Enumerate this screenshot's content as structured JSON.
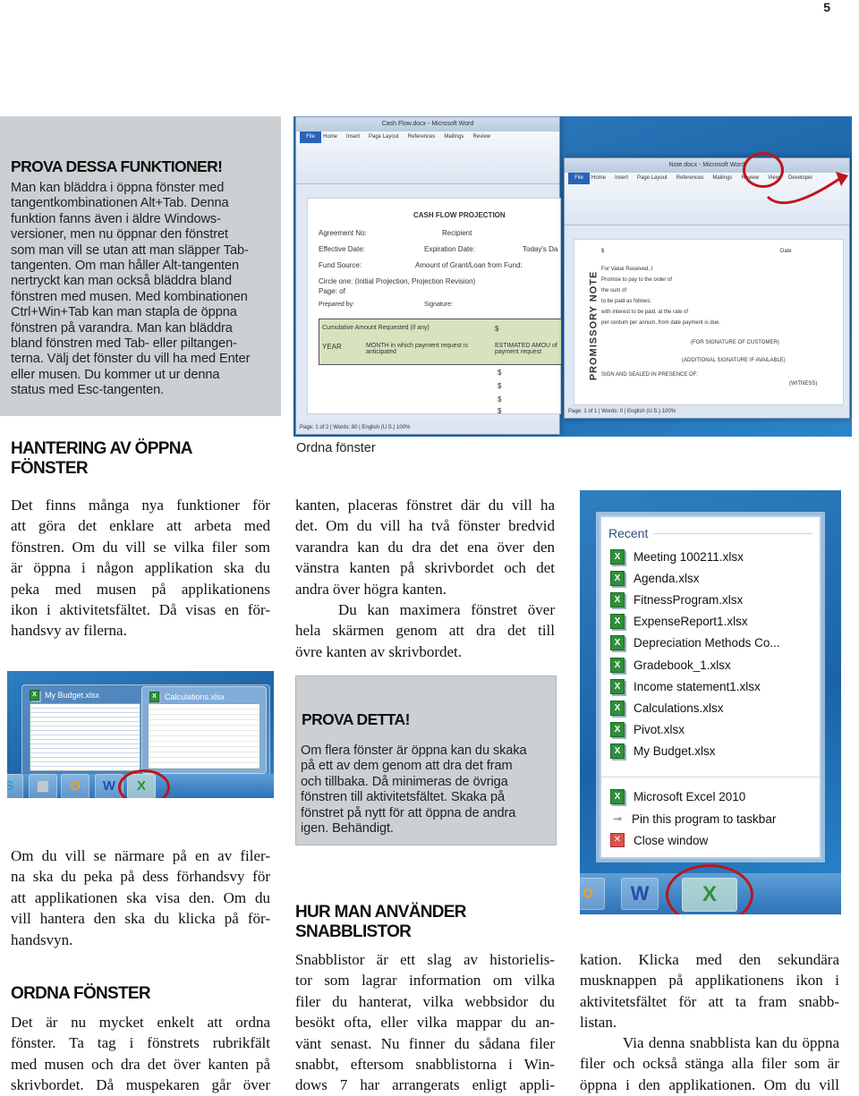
{
  "page_number": "5",
  "tip_box_1": {
    "title": "PROVA DESSA FUNKTIONER!",
    "lines": [
      "Man kan bläddra i öppna fönster med",
      "tangentkombinationen Alt+Tab. Denna",
      "funktion fanns även i äldre Windows-",
      "versioner, men nu öppnar den fönstret",
      "som man vill se utan att man släpper Tab-",
      "tangenten. Om man håller Alt-tangenten",
      "nertryckt kan man också bläddra bland",
      "fönstren med musen. Med kombinationen",
      "Ctrl+Win+Tab kan man stapla de öppna",
      "fönstren på varandra. Man kan bläddra",
      "bland fönstren med Tab- eller piltangen-",
      "terna. Välj det fönster du vill ha med Enter",
      "eller musen. Du kommer ut ur denna",
      "status med Esc-tangenten."
    ]
  },
  "screenshot_top": {
    "window1_title": "Cash Flow.docx - Microsoft Word",
    "window2_title": "Note.docx - Microsoft Word",
    "ribbon_tabs": [
      "Home",
      "Insert",
      "Page Layout",
      "References",
      "Mailings",
      "Review",
      "View",
      "Developer"
    ],
    "file_tab": "File",
    "form_title": "CASH FLOW PROJECTION",
    "form_fields": [
      "Agreement No:",
      "Recipient",
      "Effective Date:",
      "Expiration Date:",
      "Today's Da",
      "Fund Source:",
      "Amount of Grant/Loan from Fund:",
      "Circle one: (Initial Projection, Projection Revision)",
      "Page:      of",
      "Prepared by:",
      "Signature:"
    ],
    "table_cells": [
      "Cumulative Amount Requested (if any)",
      "$",
      "YEAR",
      "MONTH in which payment request is anticipated",
      "ESTIMATED AMOU of payment request"
    ],
    "dollar_signs": [
      "$",
      "$",
      "$",
      "$"
    ],
    "note_side_title": "PROMISSORY NOTE",
    "note_fields": [
      "$",
      "Date",
      "For Value Received, I",
      "Promise to pay to the order of",
      "the sum of",
      "to be paid as follows:",
      "with interest to be paid, at the rate of",
      "per centum per annum, from date payment is due.",
      "(FOR SIGNATURE OF CUSTOMER)",
      "(ADDITIONAL SIGNATURE IF AVAILABLE)",
      "SIGN AND SEALED IN PRESENCE OF:",
      "(WITNESS)"
    ],
    "status1": "Page: 1 of 2 | Words: 80 | English (U.S.)   100%",
    "status2": "Page: 1 of 1 | Words: 0 | English (U.S.)   100%"
  },
  "section_hantering": {
    "heading_lines": [
      "HANTERING AV ÖPPNA",
      "FÖNSTER"
    ],
    "lines": [
      "Det finns många nya funktioner för",
      "att göra det enklare att arbeta med",
      "fönstren. Om du vill se vilka filer som",
      "är öppna i någon applikation ska du",
      "peka med musen på applikationens",
      "ikon i aktivitetsfältet. Då visas en för-",
      "handsvy av filerna."
    ],
    "lines2": [
      "Om du vill se närmare på en av filer-",
      "na ska du peka på dess förhandsvy för",
      "att applikationen ska visa den. Om du",
      "vill hantera den ska du klicka på för-",
      "handsvyn."
    ]
  },
  "caption_ordna": "Ordna fönster",
  "column_mid": {
    "lines": [
      "kanten, placeras fönstret där du vill ha",
      "det. Om du vill ha två fönster bredvid",
      "varandra kan du dra det ena över den",
      "vänstra kanten på skrivbordet och det",
      "andra över högra kanten."
    ],
    "lines2": [
      "Du kan maximera fönstret över",
      "hela skärmen genom att dra det till",
      "övre kanten av skrivbordet."
    ]
  },
  "screenshot_previews": {
    "thumb1_title": "My Budget.xlsx",
    "thumb2_title": "Calculations.xlsx",
    "taskbar_icons": [
      "skype",
      "calculator",
      "outlook",
      "word",
      "excel"
    ]
  },
  "tip_box_2": {
    "title": "PROVA DETTA!",
    "lines": [
      "Om flera fönster är öppna kan du skaka",
      "på ett av dem genom att dra det fram",
      "och tillbaka. Då minimeras de övriga",
      "fönstren till aktivitetsfältet. Skaka på",
      "fönstret på nytt för att öppna de andra",
      "igen. Behändigt."
    ]
  },
  "jump_list": {
    "section_title": "Recent",
    "recent_items": [
      "Meeting 100211.xlsx",
      "Agenda.xlsx",
      "FitnessProgram.xlsx",
      "ExpenseReport1.xlsx",
      "Depreciation Methods Co...",
      "Gradebook_1.xlsx",
      "Income statement1.xlsx",
      "Calculations.xlsx",
      "Pivot.xlsx",
      "My Budget.xlsx"
    ],
    "tasks": [
      {
        "label": "Microsoft Excel 2010",
        "icon": "excel-icon"
      },
      {
        "label": "Pin this program to taskbar",
        "icon": "pin-icon"
      },
      {
        "label": "Close window",
        "icon": "close-icon"
      }
    ]
  },
  "section_ordna": {
    "heading": "ORDNA FÖNSTER",
    "lines": [
      "Det är nu mycket enkelt att ordna",
      "fönster. Ta tag i fönstrets rubrikfält",
      "med musen och dra det över kanten på",
      "skrivbordet. Då muspekaren går över"
    ]
  },
  "section_snabblistor": {
    "heading_lines": [
      "HUR MAN ANVÄNDER",
      "SNABBLISTOR"
    ],
    "lines": [
      "Snabblistor är ett slag av historielis-",
      "tor som lagrar information om vilka",
      "filer du hanterat, vilka webbsidor du",
      "besökt ofta, eller vilka mappar du an-",
      "vänt senast. Nu finner du sådana filer",
      "snabbt, eftersom snabblistorna i Win-",
      "dows 7 har arrangerats enligt appli-"
    ],
    "lines_right": [
      "kation. Klicka med den sekundära",
      "musknappen på applikationens ikon i",
      "aktivitetsfältet för att ta fram snabb-",
      "listan."
    ],
    "lines_right2": [
      "Via denna snabblista kan du öppna",
      "filer och också stänga alla filer som är",
      "öppna i den applikationen. Om du vill"
    ]
  },
  "colors": {
    "tip_box_bg": "#cdd0d2",
    "highlight_red": "#c0141c",
    "excel_green": "#2f8f3a"
  }
}
